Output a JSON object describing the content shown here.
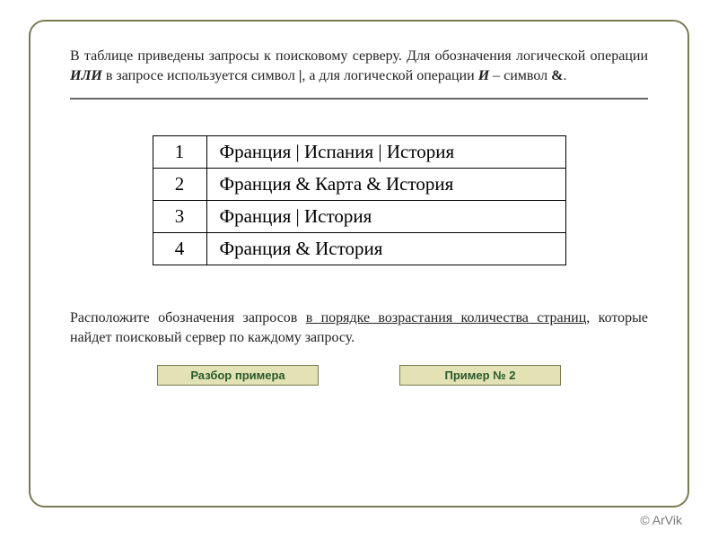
{
  "intro": {
    "part1": "В таблице приведены запросы к поисковому серверу. Для обозначения логической операции ",
    "or_word": "ИЛИ",
    "part2": " в запросе используется символ ",
    "pipe": "|",
    "part3": ", а для логической операции ",
    "and_word": "И",
    "part4": " – символ ",
    "amp": "&",
    "part5": "."
  },
  "table": {
    "rows": [
      {
        "num": "1",
        "query": "Франция | Испания | История"
      },
      {
        "num": "2",
        "query": "Франция & Карта & История"
      },
      {
        "num": "3",
        "query": "Франция | История"
      },
      {
        "num": "4",
        "query": "Франция & История"
      }
    ]
  },
  "task": {
    "part1": "Расположите обозначения запросов ",
    "underlined": "в порядке возрастания количества страниц",
    "part2": ", которые найдет поисковый сервер по каждому запросу."
  },
  "buttons": {
    "analyze": "Разбор примера",
    "example2": "Пример № 2"
  },
  "copyright": "© ArVik"
}
